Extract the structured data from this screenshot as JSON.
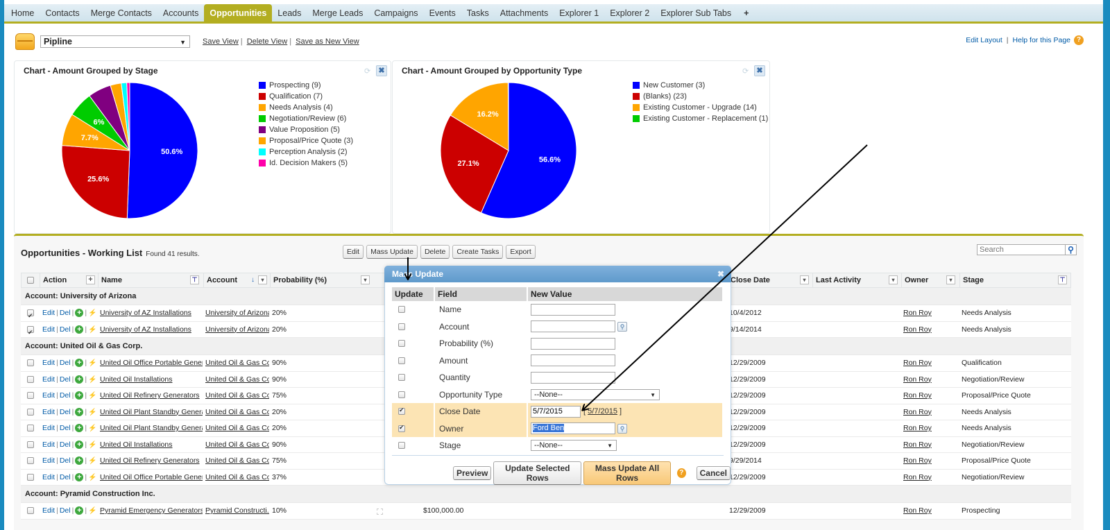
{
  "tabs": [
    {
      "label": "Home",
      "active": false
    },
    {
      "label": "Contacts",
      "active": false
    },
    {
      "label": "Merge Contacts",
      "active": false
    },
    {
      "label": "Accounts",
      "active": false
    },
    {
      "label": "Opportunities",
      "active": true
    },
    {
      "label": "Leads",
      "active": false
    },
    {
      "label": "Merge Leads",
      "active": false
    },
    {
      "label": "Campaigns",
      "active": false
    },
    {
      "label": "Events",
      "active": false
    },
    {
      "label": "Tasks",
      "active": false
    },
    {
      "label": "Attachments",
      "active": false
    },
    {
      "label": "Explorer 1",
      "active": false
    },
    {
      "label": "Explorer 2",
      "active": false
    },
    {
      "label": "Explorer Sub Tabs",
      "active": false
    }
  ],
  "tab_add_label": "+",
  "view": {
    "selected": "Pipline",
    "links": [
      "Save View",
      "Delete View",
      "Save as New View"
    ]
  },
  "top_links": {
    "edit_layout": "Edit Layout",
    "help": "Help for this Page",
    "help_glyph": "?"
  },
  "charts": [
    {
      "title": "Chart - Amount Grouped by Stage",
      "refresh_glyph": "⟳",
      "close_glyph": "✖"
    },
    {
      "title": "Chart - Amount Grouped by Opportunity Type",
      "refresh_glyph": "⟳",
      "close_glyph": "✖"
    }
  ],
  "chart_data": [
    {
      "type": "pie",
      "title": "Chart - Amount Grouped by Stage",
      "legend_position": "right",
      "slices": [
        {
          "label": "Prospecting (9)",
          "value": 50.6,
          "color": "#0000ff",
          "show_label": "50.6%"
        },
        {
          "label": "Qualification (7)",
          "value": 25.6,
          "color": "#cc0000",
          "show_label": "25.6%"
        },
        {
          "label": "Needs Analysis (4)",
          "value": 7.7,
          "color": "#ffa500",
          "show_label": "7.7%"
        },
        {
          "label": "Negotiation/Review (6)",
          "value": 6.0,
          "color": "#00cc00",
          "show_label": "6%"
        },
        {
          "label": "Value Proposition (5)",
          "value": 5.5,
          "color": "#800080",
          "show_label": ""
        },
        {
          "label": "Proposal/Price Quote (3)",
          "value": 2.6,
          "color": "#ffa500",
          "show_label": ""
        },
        {
          "label": "Perception Analysis (2)",
          "value": 1.3,
          "color": "#00ffff",
          "show_label": ""
        },
        {
          "label": "Id. Decision Makers (5)",
          "value": 0.7,
          "color": "#ff00aa",
          "show_label": ""
        }
      ]
    },
    {
      "type": "pie",
      "title": "Chart - Amount Grouped by Opportunity Type",
      "legend_position": "right",
      "slices": [
        {
          "label": "New Customer (3)",
          "value": 56.6,
          "color": "#0000ff",
          "show_label": "56.6%"
        },
        {
          "label": "(Blanks) (23)",
          "value": 27.1,
          "color": "#cc0000",
          "show_label": "27.1%"
        },
        {
          "label": "Existing Customer - Upgrade (14)",
          "value": 16.2,
          "color": "#ffa500",
          "show_label": "16.2%"
        },
        {
          "label": "Existing Customer - Replacement (1)",
          "value": 0.1,
          "color": "#00cc00",
          "show_label": ""
        }
      ]
    }
  ],
  "list": {
    "title": "Opportunities - Working List",
    "count": "Found 41 results.",
    "buttons": [
      "Edit",
      "Mass Update",
      "Delete",
      "Create Tasks",
      "Export"
    ],
    "search_placeholder": "Search",
    "columns": {
      "action": "Action",
      "name": "Name",
      "account": "Account",
      "probability": "Probability (%)",
      "close_date": "Close Date",
      "last_activity": "Last Activity",
      "owner": "Owner",
      "stage": "Stage"
    },
    "row_actions": {
      "edit": "Edit",
      "del": "Del"
    },
    "groups": [
      {
        "label": "Account: University of Arizona",
        "rows": [
          {
            "checked": true,
            "name": "University of AZ Installations",
            "account": "University of Arizona",
            "probability": "20%",
            "amount": "",
            "close_date": "10/4/2012",
            "owner": "Ron Roy",
            "stage": "Needs Analysis"
          },
          {
            "checked": true,
            "name": "University of AZ Installations",
            "account": "University of Arizona",
            "probability": "20%",
            "amount": "",
            "close_date": "9/14/2014",
            "owner": "Ron Roy",
            "stage": "Needs Analysis"
          }
        ]
      },
      {
        "label": "Account: United Oil & Gas Corp.",
        "rows": [
          {
            "checked": false,
            "name": "United Oil Office Portable Generat...",
            "account": "United Oil & Gas Co...",
            "probability": "90%",
            "amount": "",
            "close_date": "12/29/2009",
            "owner": "Ron Roy",
            "stage": "Qualification"
          },
          {
            "checked": false,
            "name": "United Oil Installations",
            "account": "United Oil & Gas Co...",
            "probability": "90%",
            "amount": "",
            "close_date": "12/29/2009",
            "owner": "Ron Roy",
            "stage": "Negotiation/Review"
          },
          {
            "checked": false,
            "name": "United Oil Refinery Generators",
            "account": "United Oil & Gas Co...",
            "probability": "75%",
            "amount": "",
            "close_date": "12/29/2009",
            "owner": "Ron Roy",
            "stage": "Proposal/Price Quote"
          },
          {
            "checked": false,
            "name": "United Oil Plant Standby Generators",
            "account": "United Oil & Gas Co...",
            "probability": "20%",
            "amount": "",
            "close_date": "12/29/2009",
            "owner": "Ron Roy",
            "stage": "Needs Analysis"
          },
          {
            "checked": false,
            "name": "United Oil Plant Standby Generators",
            "account": "United Oil & Gas Co...",
            "probability": "20%",
            "amount": "",
            "close_date": "12/29/2009",
            "owner": "Ron Roy",
            "stage": "Needs Analysis"
          },
          {
            "checked": false,
            "name": "United Oil Installations",
            "account": "United Oil & Gas Co...",
            "probability": "90%",
            "amount": "",
            "close_date": "12/29/2009",
            "owner": "Ron Roy",
            "stage": "Negotiation/Review"
          },
          {
            "checked": false,
            "name": "United Oil Refinery Generators",
            "account": "United Oil & Gas Co...",
            "probability": "75%",
            "amount": "",
            "close_date": "9/29/2014",
            "owner": "Ron Roy",
            "stage": "Proposal/Price Quote"
          },
          {
            "checked": false,
            "name": "United Oil Office Portable Generat...",
            "account": "United Oil & Gas Co...",
            "probability": "37%",
            "amount": "",
            "close_date": "12/29/2009",
            "owner": "Ron Roy",
            "stage": "Negotiation/Review"
          }
        ]
      },
      {
        "label": "Account: Pyramid Construction Inc.",
        "rows": [
          {
            "checked": false,
            "name": "Pyramid Emergency Generators",
            "account": "Pyramid Constructi...",
            "probability": "10%",
            "amount": "$100,000.00",
            "close_date": "12/29/2009",
            "owner": "Ron Roy",
            "stage": "Prospecting"
          }
        ]
      }
    ]
  },
  "mass_update": {
    "title": "Mass Update",
    "close_glyph": "✖",
    "headers": [
      "Update",
      "Field",
      "New Value"
    ],
    "fields": [
      {
        "label": "Name",
        "checked": false,
        "kind": "text",
        "value": ""
      },
      {
        "label": "Account",
        "checked": false,
        "kind": "lookup",
        "value": ""
      },
      {
        "label": "Probability (%)",
        "checked": false,
        "kind": "text",
        "value": ""
      },
      {
        "label": "Amount",
        "checked": false,
        "kind": "text",
        "value": ""
      },
      {
        "label": "Quantity",
        "checked": false,
        "kind": "text",
        "value": ""
      },
      {
        "label": "Opportunity Type",
        "checked": false,
        "kind": "select-wide",
        "value": "--None--"
      },
      {
        "label": "Close Date",
        "checked": true,
        "kind": "date",
        "value": "5/7/2015",
        "today_link": "5/7/2015"
      },
      {
        "label": "Owner",
        "checked": true,
        "kind": "lookup-selected",
        "value": "Ford Ben"
      },
      {
        "label": "Stage",
        "checked": false,
        "kind": "select",
        "value": "--None--"
      }
    ],
    "buttons": {
      "preview": "Preview",
      "update_selected": "Update Selected Rows",
      "mass_update_all": "Mass Update All Rows",
      "help_glyph": "?",
      "cancel": "Cancel"
    }
  }
}
